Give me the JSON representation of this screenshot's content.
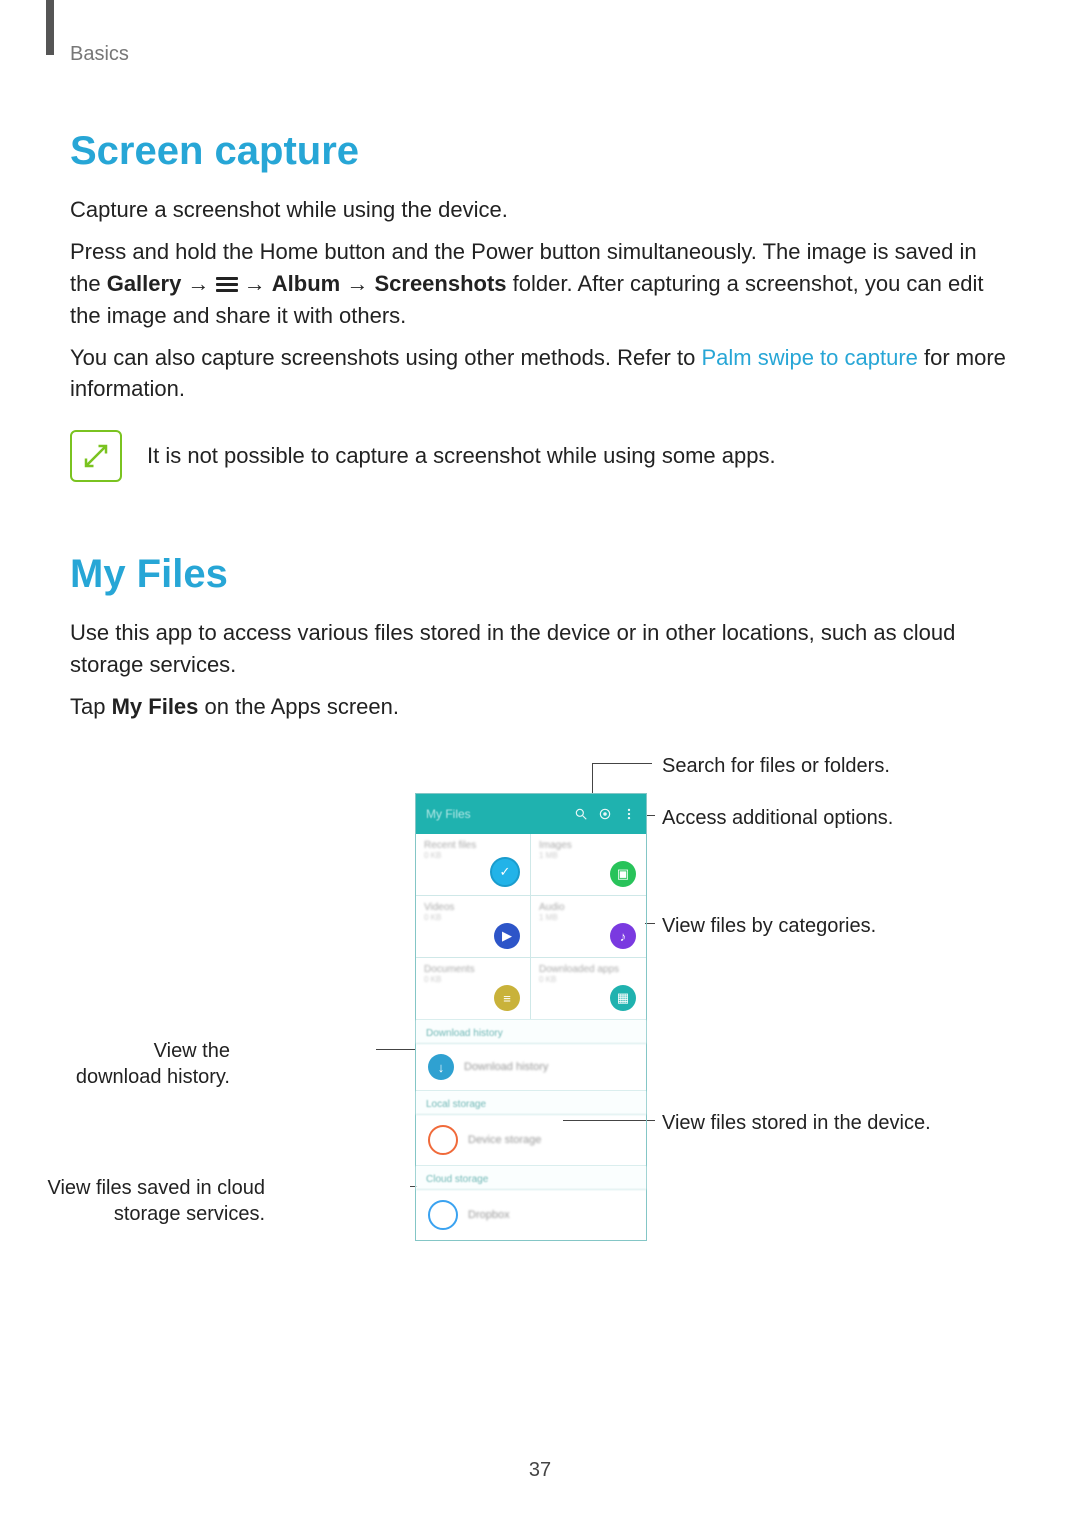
{
  "section_label": "Basics",
  "screen_capture": {
    "heading": "Screen capture",
    "p1": "Capture a screenshot while using the device.",
    "p2_a": "Press and hold the Home button and the Power button simultaneously. The image is saved in the ",
    "p2_gallery": "Gallery",
    "p2_arrow1": " → ",
    "p2_arrow2": " → ",
    "p2_album": "Album",
    "p2_arrow3": " → ",
    "p2_screenshots": "Screenshots",
    "p2_b": " folder. After capturing a screenshot, you can edit the image and share it with others.",
    "p3_a": "You can also capture screenshots using other methods. Refer to ",
    "p3_link": "Palm swipe to capture",
    "p3_b": " for more information.",
    "note": "It is not possible to capture a screenshot while using some apps."
  },
  "my_files": {
    "heading": "My Files",
    "p1": "Use this app to access various files stored in the device or in other locations, such as cloud storage services.",
    "p2_a": "Tap ",
    "p2_bold": "My Files",
    "p2_b": " on the Apps screen."
  },
  "phone": {
    "title": "My Files",
    "tiles": [
      {
        "title": "Recent files",
        "sub": "0 KB"
      },
      {
        "title": "Images",
        "sub": "1 MB"
      },
      {
        "title": "Videos",
        "sub": "0 KB"
      },
      {
        "title": "Audio",
        "sub": "1 MB"
      },
      {
        "title": "Documents",
        "sub": "0 KB"
      },
      {
        "title": "Downloaded apps",
        "sub": "0 KB"
      }
    ],
    "sec_download": "Download history",
    "row_download": "Download history",
    "sec_local": "Local storage",
    "row_device": "Device storage",
    "sec_cloud": "Cloud storage",
    "row_dropbox": "Dropbox"
  },
  "callouts": {
    "search": "Search for files or folders.",
    "options": "Access additional options.",
    "categories": "View files by categories.",
    "download_history": "View the download history.",
    "device": "View files stored in the device.",
    "cloud": "View files saved in cloud storage services."
  },
  "page_number": "37"
}
